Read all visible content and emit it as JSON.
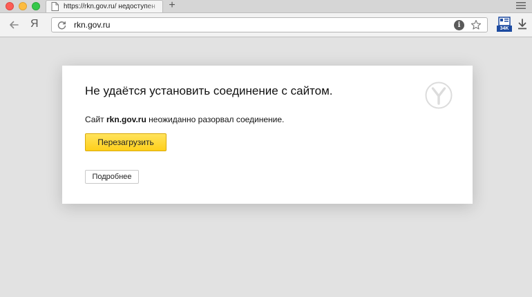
{
  "browser": {
    "tab": {
      "title": "https://rkn.gov.ru/ недоступен"
    },
    "new_tab_label": "+",
    "yandex_button_label": "Я",
    "address_bar": {
      "url": "rkn.gov.ru"
    },
    "extension": {
      "badge": "34K"
    }
  },
  "error_page": {
    "title": "Не удаётся установить соединение с сайтом.",
    "message_prefix": "Сайт ",
    "site": "rkn.gov.ru",
    "message_suffix": " неожиданно разорвал соединение.",
    "reload_button": "Перезагрузить",
    "details_button": "Подробнее"
  },
  "colors": {
    "reload_button_bg": "#ffd42a",
    "page_background": "#e2e2e2",
    "card_background": "#ffffff",
    "extension_badge": "#1c4aa0"
  },
  "icons": {
    "window_controls": [
      "close-window-icon",
      "minimize-window-icon",
      "zoom-window-icon"
    ],
    "tab": "page-icon",
    "menu": "hamburger-menu-icon",
    "back": "back-arrow-icon",
    "reload": "reload-icon",
    "info": "info-icon",
    "bookmark": "star-icon",
    "download": "download-icon",
    "logo": "yandex-browser-logo-icon"
  }
}
